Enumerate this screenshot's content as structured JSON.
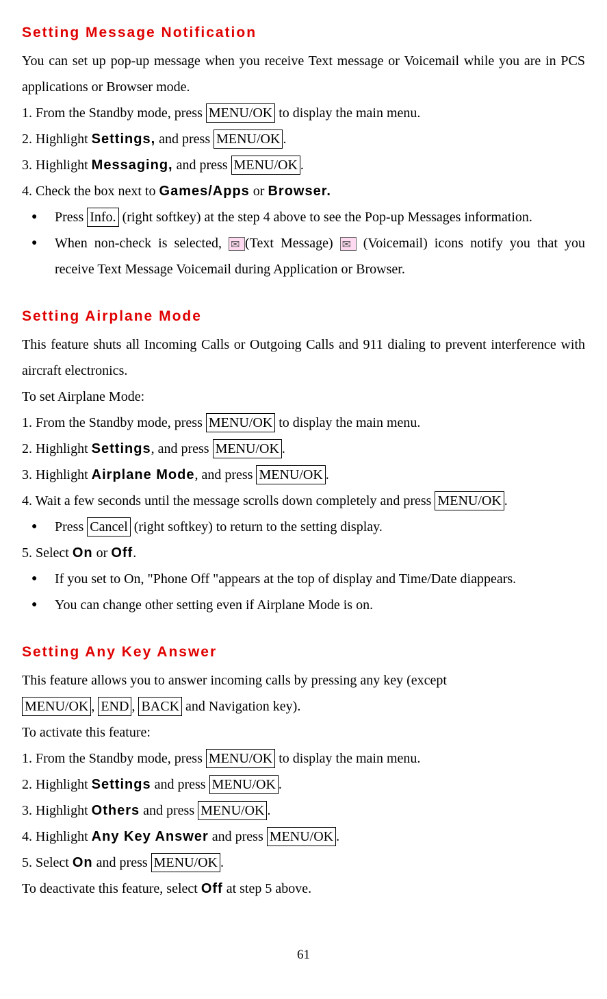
{
  "section1": {
    "title": "Setting Message Notification",
    "intro": "You can set up pop-up message when you receive Text message or Voicemail while you are in PCS applications or Browser mode.",
    "step1_pre": "1. From the Standby mode, press ",
    "menuok": "MENU/OK",
    "step1_post": " to display the main menu.",
    "step2_pre": "2. Highlight ",
    "settings": "Settings,",
    "step2_mid": " and press ",
    "step3_pre": "3. Highlight ",
    "messaging": "Messaging,",
    "step4_pre": "4. Check the box next to ",
    "games": "Games/Apps",
    "or": " or ",
    "browser": "Browser.",
    "bullet1_pre": "Press ",
    "info": "Info.",
    "bullet1_post": " (right softkey) at the step 4 above to see the Pop-up Messages information.",
    "bullet2_pre": "When non-check is selected, ",
    "bullet2_mid1": "(Text Message) ",
    "bullet2_mid2": " (Voicemail) icons notify you that you receive Text Message Voicemail during Application or Browser."
  },
  "section2": {
    "title": "Setting Airplane Mode",
    "intro": "This feature shuts all Incoming Calls or Outgoing Calls and 911 dialing to prevent interference with aircraft electronics.",
    "toset": "To set Airplane Mode:",
    "s1_pre": "1.   From the Standby mode, press ",
    "s1_post": " to display the main menu.",
    "s2_pre": "2.   Highlight ",
    "settings": "Settings",
    "s2_mid": ", and press ",
    "s3_pre": "3.   Highlight ",
    "airplane": "Airplane Mode",
    "s4": "4.   Wait a few seconds until the message scrolls down completely and press ",
    "b1_pre": "Press ",
    "cancel": "Cancel",
    "b1_post": " (right softkey) to return to the setting display.",
    "s5_pre": "5.   Select ",
    "on": "On",
    "s5_mid": " or ",
    "off": "Off",
    "b2": "If you set to On, \"Phone Off \"appears at the top of display and Time/Date diappears.",
    "b3": "You can change other setting even if Airplane Mode is on."
  },
  "section3": {
    "title": "Setting Any Key Answer",
    "intro_pre": "This feature allows you to answer incoming calls by pressing any key (except",
    "end": "END",
    "back": "BACK",
    "intro_post": " and Navigation key).",
    "toactivate": "To activate this feature:",
    "s1_pre": "1. From the Standby mode, press ",
    "s1_post": " to display the main menu.",
    "s2_pre": "2. Highlight ",
    "settings": "Settings",
    "and_press": " and press ",
    "s3_pre": "3. Highlight ",
    "others": "Others",
    "s4_pre": "4. Highlight ",
    "anykey": "Any Key Answer",
    "s5_pre": "5. Select ",
    "on": "On",
    "deact_pre": "To deactivate this feature, select ",
    "off": "Off",
    "deact_post": " at step 5 above."
  },
  "pageNumber": "61",
  "period": ".",
  "comma_sp": ", "
}
